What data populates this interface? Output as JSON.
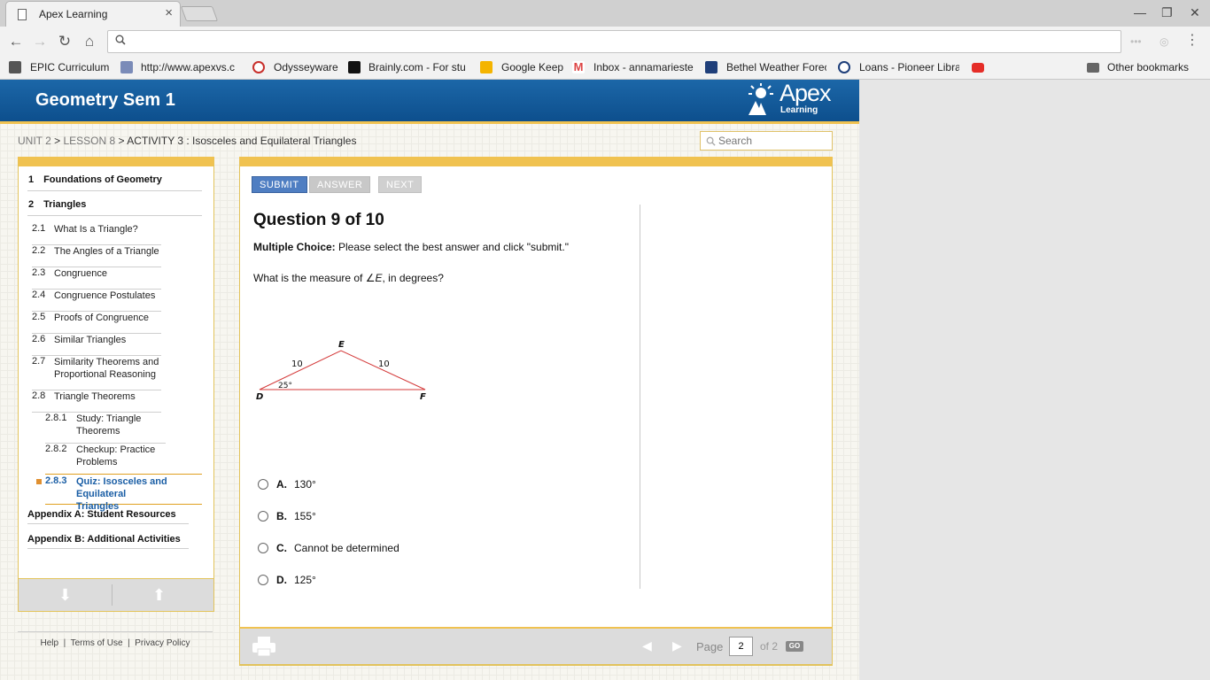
{
  "browser": {
    "tab_title": "Apex Learning",
    "tab_close": "×",
    "address": "",
    "window_controls": {
      "minimize": "—",
      "restore": "❐",
      "close": "✕"
    },
    "bookmarks": [
      {
        "label": "EPIC Curriculum",
        "icon": "folder-apps-icon"
      },
      {
        "label": "http://www.apexvs.c",
        "icon": "apex-favicon"
      },
      {
        "label": "Odysseyware",
        "icon": "odysseyware-favicon"
      },
      {
        "label": "Brainly.com - For stu",
        "icon": "brainly-favicon"
      },
      {
        "label": "Google Keep",
        "icon": "keep-favicon"
      },
      {
        "label": "Inbox - annamarieste",
        "icon": "gmail-favicon"
      },
      {
        "label": "Bethel Weather Forec",
        "icon": "weather-favicon"
      },
      {
        "label": "Loans - Pioneer Libra",
        "icon": "pioneer-favicon"
      },
      {
        "label": "",
        "icon": "youtube-favicon"
      }
    ],
    "other_bookmarks": "Other bookmarks"
  },
  "header": {
    "course_title": "Geometry Sem 1",
    "logo_word": "Apex",
    "logo_sub": "Learning"
  },
  "breadcrumb": {
    "unit": "UNIT 2",
    "sep1": " > ",
    "lesson": "LESSON 8",
    "sep2": " > ",
    "activity": "ACTIVITY 3 : Isosceles and Equilateral Triangles"
  },
  "search": {
    "placeholder": "Search"
  },
  "sidebar": {
    "units": [
      {
        "num": "1",
        "label": "Foundations of Geometry"
      },
      {
        "num": "2",
        "label": "Triangles"
      }
    ],
    "lessons": [
      {
        "num": "2.1",
        "label": "What Is a Triangle?"
      },
      {
        "num": "2.2",
        "label": "The Angles of a Triangle"
      },
      {
        "num": "2.3",
        "label": "Congruence"
      },
      {
        "num": "2.4",
        "label": "Congruence Postulates"
      },
      {
        "num": "2.5",
        "label": "Proofs of Congruence"
      },
      {
        "num": "2.6",
        "label": "Similar Triangles"
      },
      {
        "num": "2.7",
        "label": "Similarity Theorems and Proportional Reasoning"
      },
      {
        "num": "2.8",
        "label": "Triangle Theorems"
      }
    ],
    "sublessons": [
      {
        "num": "2.8.1",
        "label": "Study: Triangle Theorems"
      },
      {
        "num": "2.8.2",
        "label": "Checkup: Practice Problems"
      },
      {
        "num": "2.8.3",
        "label": "Quiz: Isosceles and Equilateral Triangles"
      }
    ],
    "appendices": [
      "Appendix A: Student Resources",
      "Appendix B: Additional Activities"
    ]
  },
  "footer_links": {
    "help": "Help",
    "terms": "Terms of Use",
    "privacy": "Privacy Policy",
    "sep": "|"
  },
  "question": {
    "buttons": {
      "submit": "SUBMIT",
      "answer": "ANSWER",
      "next": "NEXT"
    },
    "title": "Question 9 of 10",
    "instruction_bold": "Multiple Choice:",
    "instruction_rest": " Please select the best answer and click \"submit.\"",
    "prompt_pre": "What is the measure of ",
    "prompt_angle": "∠E",
    "prompt_post": ", in degrees?",
    "figure": {
      "vertices": [
        "D",
        "E",
        "F"
      ],
      "side_de": "10",
      "side_ef": "10",
      "angle_d": "25°",
      "color": "#d43a3a"
    },
    "choices": [
      {
        "letter": "A.",
        "text": "130°"
      },
      {
        "letter": "B.",
        "text": "155°"
      },
      {
        "letter": "C.",
        "text": "Cannot be determined"
      },
      {
        "letter": "D.",
        "text": "125°"
      }
    ]
  },
  "pager": {
    "page_label": "Page",
    "page_value": "2",
    "of_label": "of 2",
    "go": "GO"
  },
  "colors": {
    "accent": "#f0c250",
    "header_blue": "#1c67a8",
    "submit_blue": "#4f7ec2",
    "active_link": "#1a5ea5"
  }
}
